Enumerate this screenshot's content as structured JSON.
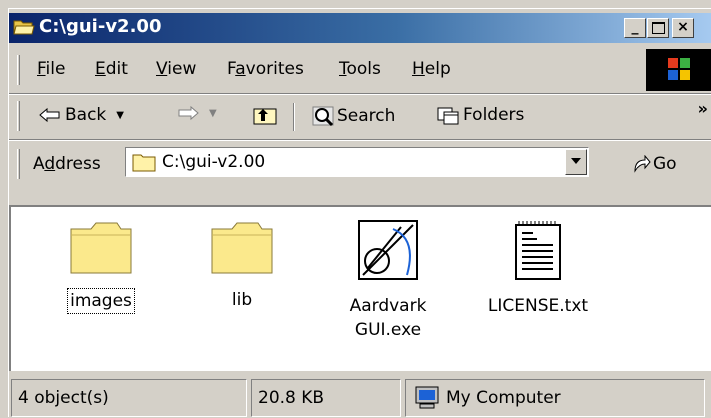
{
  "window": {
    "title": "C:\\gui-v2.00"
  },
  "menu": [
    {
      "label": "File",
      "accel": "F",
      "rest": "ile"
    },
    {
      "label": "Edit",
      "accel": "E",
      "rest": "dit"
    },
    {
      "label": "View",
      "accel": "V",
      "rest": "iew"
    },
    {
      "label": "Favorites",
      "pre": "F",
      "accel": "a",
      "rest": "vorites"
    },
    {
      "label": "Tools",
      "accel": "T",
      "rest": "ools"
    },
    {
      "label": "Help",
      "accel": "H",
      "rest": "elp"
    }
  ],
  "toolbar": {
    "back": "Back",
    "search": "Search",
    "folders": "Folders",
    "more": "»"
  },
  "address": {
    "label": "Address",
    "label_pre": "A",
    "label_accel": "d",
    "label_rest": "dress",
    "value": "C:\\gui-v2.00",
    "go": "Go"
  },
  "files": [
    {
      "name": "images",
      "icon": "folder-icon"
    },
    {
      "name": "lib",
      "icon": "folder-icon"
    },
    {
      "name": "Aardvark GUI.exe",
      "line1": "Aardvark",
      "line2": "GUI.exe",
      "icon": "exe-icon"
    },
    {
      "name": "LICENSE.txt",
      "icon": "text-file-icon"
    }
  ],
  "status": {
    "objects": "4 object(s)",
    "size": "20.8 KB",
    "zone": "My Computer"
  }
}
